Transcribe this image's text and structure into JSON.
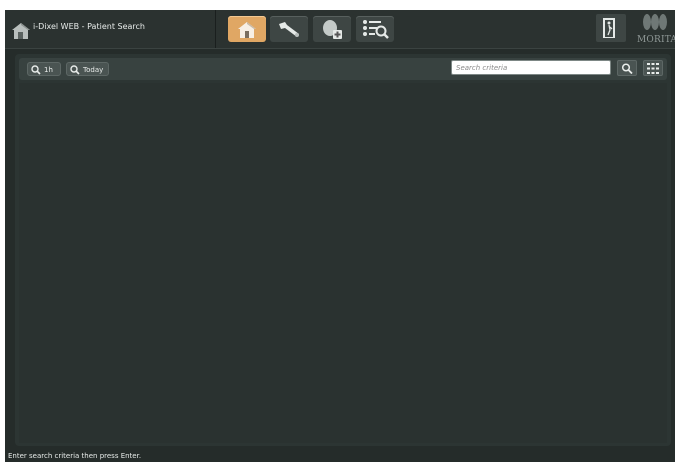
{
  "titlebar": {
    "title": "i-Dixel WEB - Patient Search",
    "home_icon": "house-icon"
  },
  "toolbar": {
    "buttons": [
      {
        "name": "home",
        "icon": "house-icon",
        "active": true
      },
      {
        "name": "settings",
        "icon": "wrench-icon",
        "active": false
      },
      {
        "name": "add-patient",
        "icon": "patient-add-icon",
        "active": false
      },
      {
        "name": "search-list",
        "icon": "list-search-icon",
        "active": false
      }
    ],
    "logout_icon": "exit-door-icon"
  },
  "brand": {
    "text": "MORITA"
  },
  "filter_bar": {
    "btn_1h": "1h",
    "btn_today": "Today",
    "search_placeholder": "Search criteria",
    "search_value": ""
  },
  "status": {
    "text": "Enter search criteria then press Enter."
  },
  "colors": {
    "accent": "#e0a764",
    "background": "#252c2a",
    "panel": "#2c3533"
  }
}
